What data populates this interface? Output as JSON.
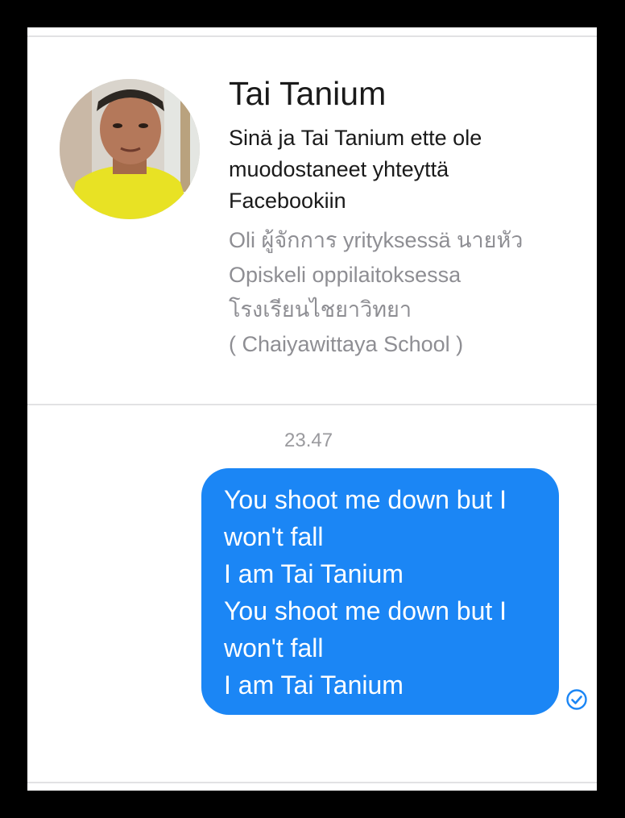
{
  "contact": {
    "name": "Tai Tanium",
    "connection_lines": [
      "Sinä ja Tai Tanium ette ole",
      "muodostaneet yhteyttä",
      "Facebookiin"
    ],
    "info_lines": [
      "Oli ผู้จักการ yrityksessä นายหัว",
      "Opiskeli oppilaitoksessa",
      "โรงเรียนไชยาวิทยา",
      "( Chaiyawittaya School )"
    ]
  },
  "conversation": {
    "timestamp": "23.47",
    "message": {
      "lines": [
        "You shoot me down but I",
        "won't fall",
        "I am Tai Tanium",
        "You shoot me down but I",
        "won't fall",
        "I am Tai Tanium"
      ],
      "status_icon": "delivered-check-icon"
    }
  },
  "colors": {
    "bubble": "#1b86f5",
    "status": "#1b86f5",
    "secondary_text": "#8e8e93"
  }
}
